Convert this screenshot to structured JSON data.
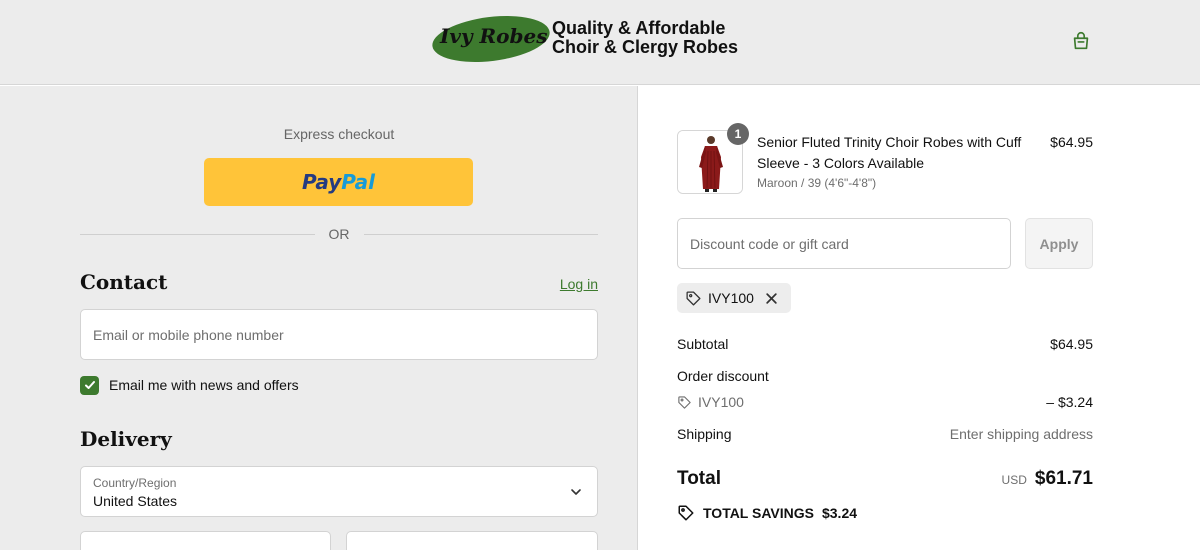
{
  "header": {
    "logo": {
      "script_text": "Ivy Robes",
      "tagline_line1": "Quality & Affordable",
      "tagline_line2": "Choir & Clergy Robes"
    },
    "cart_icon": "shopping-bag-icon"
  },
  "express": {
    "label": "Express checkout",
    "paypal_part1": "Pay",
    "paypal_part2": "Pal",
    "or_label": "OR"
  },
  "contact": {
    "title": "Contact",
    "login_label": "Log in",
    "email_placeholder": "Email or mobile phone number",
    "email_value": "",
    "news_opt_in_label": "Email me with news and offers",
    "news_opt_in_checked": true
  },
  "delivery": {
    "title": "Delivery",
    "country_label": "Country/Region",
    "country_value": "United States"
  },
  "order": {
    "item": {
      "quantity": "1",
      "name": "Senior Fluted Trinity Choir Robes with Cuff Sleeve - 3 Colors Available",
      "variant": "Maroon / 39 (4'6\"-4'8\")",
      "price": "$64.95"
    },
    "discount": {
      "placeholder": "Discount code or gift card",
      "value": "",
      "apply_label": "Apply",
      "applied_code": "IVY100"
    },
    "summary": {
      "subtotal_label": "Subtotal",
      "subtotal_value": "$64.95",
      "order_discount_label": "Order discount",
      "discount_code": "IVY100",
      "discount_value": "– $3.24",
      "shipping_label": "Shipping",
      "shipping_value": "Enter shipping address",
      "total_label": "Total",
      "currency": "USD",
      "total_value": "$61.71",
      "savings_label": "TOTAL SAVINGS",
      "savings_value": "$3.24"
    }
  },
  "colors": {
    "accent_green": "#3d7a2e",
    "paypal_yellow": "#ffc439",
    "left_panel_bg": "#ececec",
    "robe_maroon": "#8b1a1a"
  }
}
